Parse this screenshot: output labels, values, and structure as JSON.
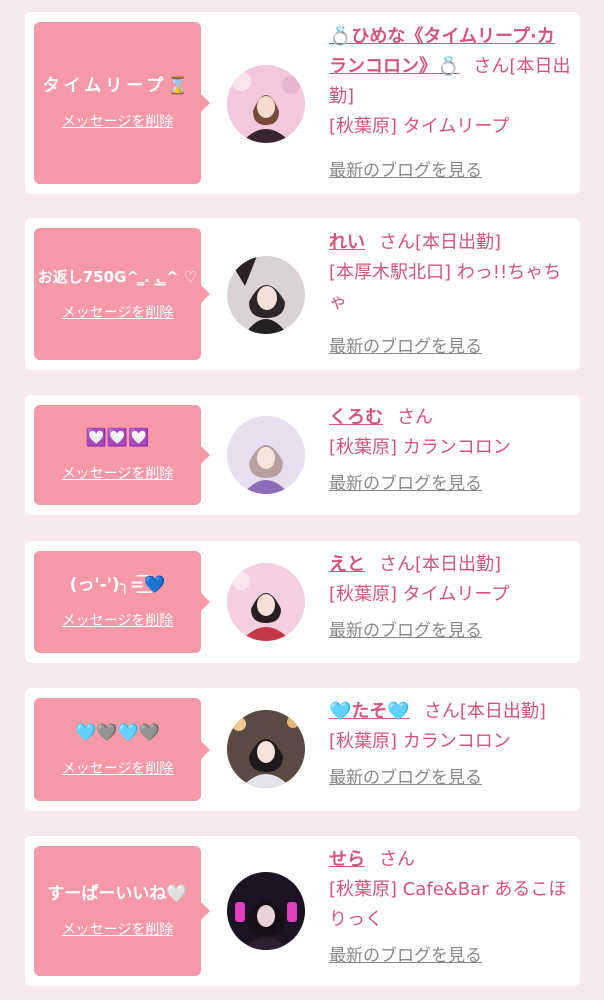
{
  "colors": {
    "accent_pink": "#f599a6",
    "text_pink": "#d3557a",
    "link_gray": "#888888",
    "page_background": "#f7e9ee"
  },
  "common": {
    "delete_label": "メッセージを削除",
    "blog_label": "最新のブログを見る"
  },
  "messages": [
    {
      "bubble_text": "タイムリープ⌛",
      "name": "💍ひめな《タイムリープ·カランコロン》💍",
      "honorific": "さん",
      "status": "[本日出勤]",
      "location": "[秋葉原] タイムリープ",
      "avatar_icon": "girl-photo-icon"
    },
    {
      "bubble_text": "お返し750G^ ̳. .̫ ̳^ ♡",
      "name": "れい",
      "honorific": "さん",
      "status": "[本日出勤]",
      "location": "[本厚木駅北口] わっ!!ちゃちゃ",
      "avatar_icon": "girl-photo-icon"
    },
    {
      "bubble_text": "💟💟💟",
      "name": "くろむ",
      "honorific": "さん",
      "status": "",
      "location": "[秋葉原] カランコロン",
      "avatar_icon": "girl-photo-icon"
    },
    {
      "bubble_text": "(っ'-')╮=͟͟͞͞💙",
      "name": "えと",
      "honorific": "さん",
      "status": "[本日出勤]",
      "location": "[秋葉原] タイムリープ",
      "avatar_icon": "girl-photo-icon"
    },
    {
      "bubble_text": "🩵🩶🩵🩶",
      "name": "🩵たそ🩵",
      "honorific": "さん",
      "status": "[本日出勤]",
      "location": "[秋葉原] カランコロン",
      "avatar_icon": "girl-photo-icon"
    },
    {
      "bubble_text": "すーぱーいいね🤍",
      "name": "せら",
      "honorific": "さん",
      "status": "",
      "location": "[秋葉原] Cafe&Bar あるこほりっく",
      "avatar_icon": "girl-photo-icon"
    }
  ]
}
